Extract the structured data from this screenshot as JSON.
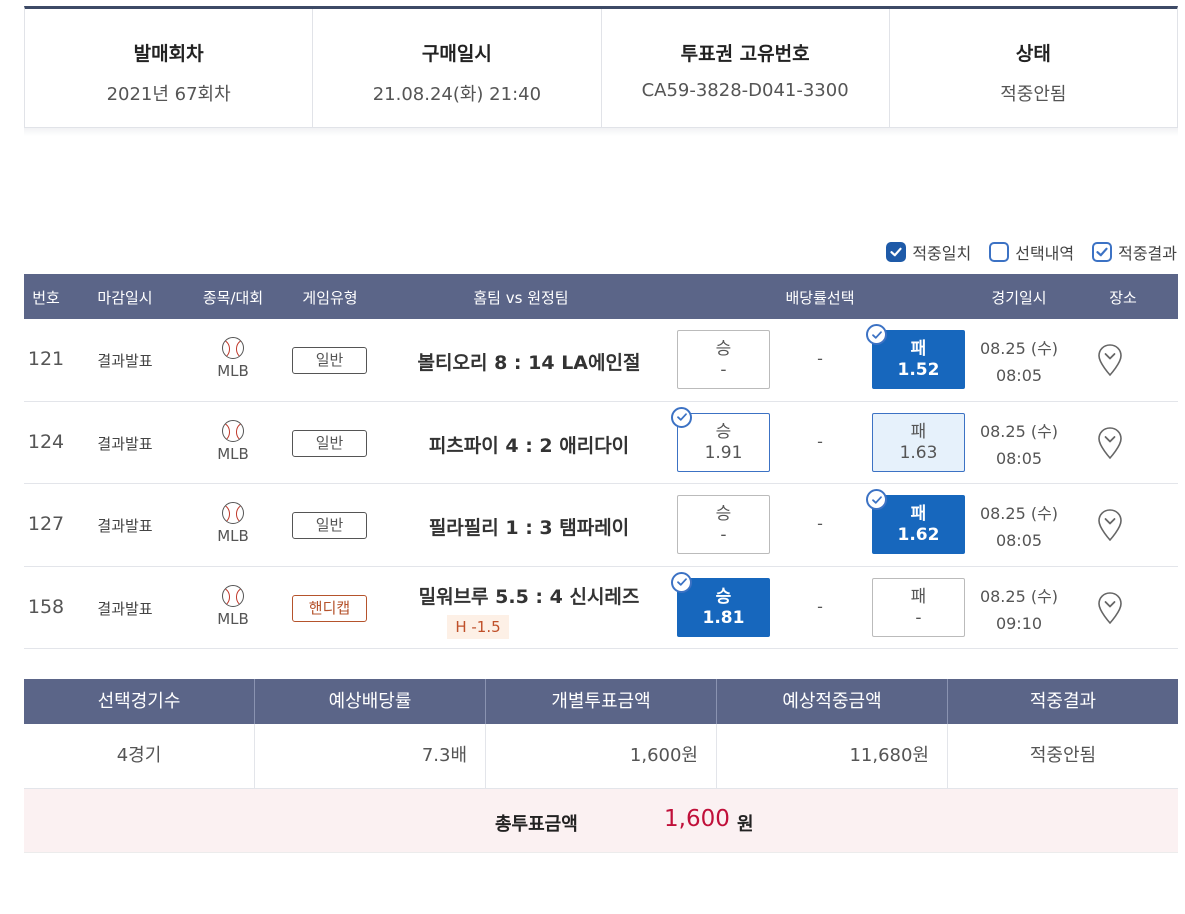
{
  "info": {
    "items": [
      {
        "label": "발매회차",
        "value": "2021년 67회차"
      },
      {
        "label": "구매일시",
        "value": "21.08.24(화) 21:40"
      },
      {
        "label": "투표권 고유번호",
        "value": "CA59-3828-D041-3300"
      },
      {
        "label": "상태",
        "value": "적중안됨"
      }
    ]
  },
  "filters": [
    {
      "label": "적중일치",
      "checked": true
    },
    {
      "label": "선택내역",
      "checked": false
    },
    {
      "label": "적중결과",
      "checked": true
    }
  ],
  "table": {
    "headers": {
      "num": "번호",
      "close": "마감일시",
      "sport": "종목/대회",
      "type": "게임유형",
      "match": "홈팀 vs 원정팀",
      "odds": "배당률선택",
      "date": "경기일시",
      "venue": "장소"
    },
    "rows": [
      {
        "num": "121",
        "close": "결과발표",
        "sport": "MLB",
        "type": "일반",
        "match": "볼티오리 8 : 14 LA에인절",
        "handicap": "",
        "win": {
          "label": "승",
          "odds": "-"
        },
        "draw": "-",
        "lose": {
          "label": "패",
          "odds": "1.52"
        },
        "date": "08.25 (수)",
        "time": "08:05"
      },
      {
        "num": "124",
        "close": "결과발표",
        "sport": "MLB",
        "type": "일반",
        "match": "피츠파이 4 : 2 애리다이",
        "handicap": "",
        "win": {
          "label": "승",
          "odds": "1.91"
        },
        "draw": "-",
        "lose": {
          "label": "패",
          "odds": "1.63"
        },
        "date": "08.25 (수)",
        "time": "08:05"
      },
      {
        "num": "127",
        "close": "결과발표",
        "sport": "MLB",
        "type": "일반",
        "match": "필라필리 1 : 3 탬파레이",
        "handicap": "",
        "win": {
          "label": "승",
          "odds": "-"
        },
        "draw": "-",
        "lose": {
          "label": "패",
          "odds": "1.62"
        },
        "date": "08.25 (수)",
        "time": "08:05"
      },
      {
        "num": "158",
        "close": "결과발표",
        "sport": "MLB",
        "type": "핸디캡",
        "match": "밀워브루 5.5 : 4 신시레즈",
        "handicap": "H -1.5",
        "win": {
          "label": "승",
          "odds": "1.81"
        },
        "draw": "-",
        "lose": {
          "label": "패",
          "odds": "-"
        },
        "date": "08.25 (수)",
        "time": "09:10"
      }
    ]
  },
  "summary": {
    "headers": [
      "선택경기수",
      "예상배당률",
      "개별투표금액",
      "예상적중금액",
      "적중결과"
    ],
    "values": [
      "4경기",
      "7.3배",
      "1,600원",
      "11,680원",
      "적중안됨"
    ],
    "total_label": "총투표금액",
    "total_amount": "1,600",
    "total_unit": "원"
  },
  "colors": {
    "header_bg": "#5b6588",
    "selected_blue": "#1767bd",
    "accent_red": "#c0103a",
    "handicap_orange": "#b5532c"
  }
}
